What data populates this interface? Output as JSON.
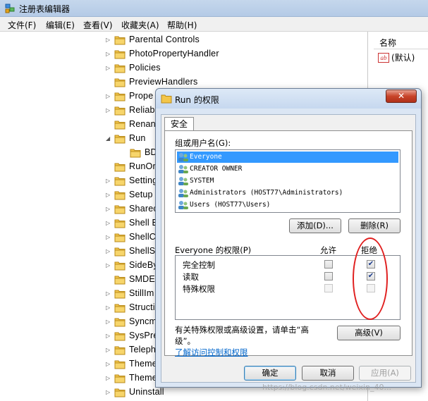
{
  "window": {
    "title": "注册表编辑器",
    "menu": [
      "文件(F)",
      "编辑(E)",
      "查看(V)",
      "收藏夹(A)",
      "帮助(H)"
    ]
  },
  "tree": {
    "items": [
      {
        "label": "Parental Controls",
        "expander": "▷"
      },
      {
        "label": "PhotoPropertyHandler",
        "expander": "▷"
      },
      {
        "label": "Policies",
        "expander": "▷"
      },
      {
        "label": "PreviewHandlers",
        "expander": ""
      },
      {
        "label": "Prope",
        "expander": "▷"
      },
      {
        "label": "Reliab",
        "expander": "▷"
      },
      {
        "label": "Renan",
        "expander": ""
      },
      {
        "label": "Run",
        "expander": "◢"
      },
      {
        "label": "BD",
        "expander": ""
      },
      {
        "label": "RunOr",
        "expander": ""
      },
      {
        "label": "Setting",
        "expander": "▷"
      },
      {
        "label": "Setup",
        "expander": "▷"
      },
      {
        "label": "Sharec",
        "expander": "▷"
      },
      {
        "label": "Shell E",
        "expander": "▷"
      },
      {
        "label": "ShellC",
        "expander": "▷"
      },
      {
        "label": "ShellS",
        "expander": "▷"
      },
      {
        "label": "SideBy",
        "expander": "▷"
      },
      {
        "label": "SMDE",
        "expander": ""
      },
      {
        "label": "StillIm",
        "expander": "▷"
      },
      {
        "label": "Structi",
        "expander": "▷"
      },
      {
        "label": "Syncm",
        "expander": "▷"
      },
      {
        "label": "SysPre",
        "expander": "▷"
      },
      {
        "label": "Teleph",
        "expander": "▷"
      },
      {
        "label": "Theme",
        "expander": "▷"
      },
      {
        "label": "Theme",
        "expander": "▷"
      },
      {
        "label": "Uninstall",
        "expander": "▷"
      }
    ]
  },
  "values_pane": {
    "column_name": "名称",
    "rows": [
      {
        "icon": "ab",
        "label": "(默认)"
      }
    ]
  },
  "dialog": {
    "title": "Run 的权限",
    "close_label": "✕",
    "tab_label": "安全",
    "group_label": "组或用户名(G):",
    "users": [
      "Everyone",
      "CREATOR OWNER",
      "SYSTEM",
      "Administrators (HOST77\\Administrators)",
      "Users (HOST77\\Users)"
    ],
    "add_button": "添加(D)...",
    "remove_button": "删除(R)",
    "perm_header": "Everyone 的权限(P)",
    "allow_header": "允许",
    "deny_header": "拒绝",
    "permissions": [
      {
        "name": "完全控制",
        "allow": false,
        "deny": true,
        "enabled": true
      },
      {
        "name": "读取",
        "allow": false,
        "deny": true,
        "enabled": true
      },
      {
        "name": "特殊权限",
        "allow": false,
        "deny": false,
        "enabled": false
      }
    ],
    "special_text_line1": "有关特殊权限或高级设置，请单击“高",
    "special_text_line2": "级”。",
    "advanced_button": "高级(V)",
    "link_text": "了解访问控制和权限",
    "ok_button": "确定",
    "cancel_button": "取消",
    "apply_button": "应用(A)"
  },
  "watermark": "https://blog.csdn.net/weixin_40..."
}
